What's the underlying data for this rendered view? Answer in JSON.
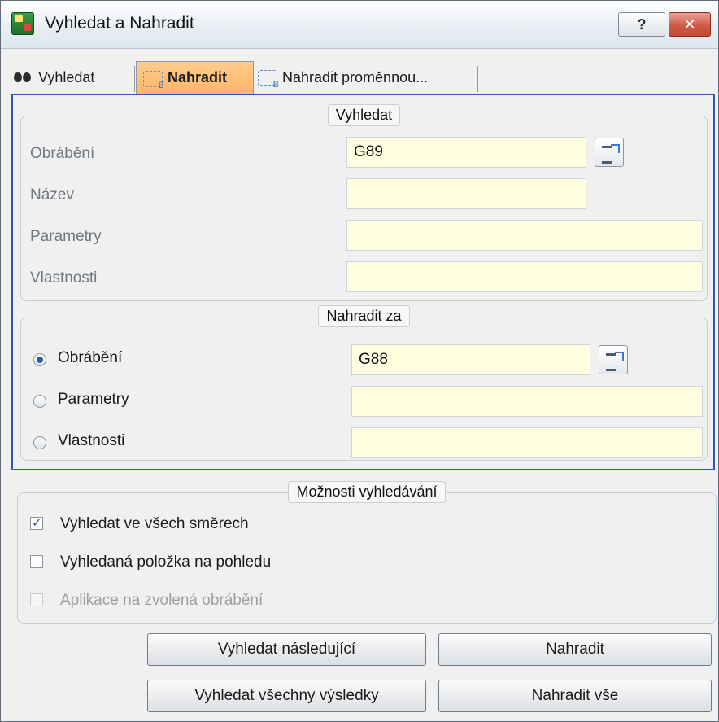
{
  "window": {
    "title": "Vyhledat a Nahradit",
    "help_label": "?",
    "close_label": "✕"
  },
  "tabs": [
    {
      "label": "Vyhledat",
      "icon": "binoculars-icon",
      "active": false
    },
    {
      "label": "Nahradit",
      "icon": "replace-icon",
      "active": true
    },
    {
      "label": "Nahradit proměnnou...",
      "icon": "replace-variable-icon",
      "active": false
    }
  ],
  "search_group": {
    "title": "Vyhledat",
    "fields": [
      {
        "label": "Obrábění",
        "value": "G89"
      },
      {
        "label": "Název",
        "value": ""
      },
      {
        "label": "Parametry",
        "value": ""
      },
      {
        "label": "Vlastnosti",
        "value": ""
      }
    ]
  },
  "replace_group": {
    "title": "Nahradit za",
    "options": [
      {
        "label": "Obrábění",
        "value": "G88",
        "selected": true
      },
      {
        "label": "Parametry",
        "value": "",
        "selected": false
      },
      {
        "label": "Vlastnosti",
        "value": "",
        "selected": false
      }
    ]
  },
  "options_group": {
    "title": "Možnosti vyhledávání",
    "checkboxes": [
      {
        "label": "Vyhledat ve všech směrech",
        "checked": true,
        "enabled": true
      },
      {
        "label": "Vyhledaná položka na pohledu",
        "checked": false,
        "enabled": true
      },
      {
        "label": "Aplikace na zvolená obrábění",
        "checked": false,
        "enabled": false
      }
    ]
  },
  "buttons": {
    "find_next": "Vyhledat následující",
    "replace": "Nahradit",
    "find_all": "Vyhledat všechny výsledky",
    "replace_all": "Nahradit vše"
  }
}
